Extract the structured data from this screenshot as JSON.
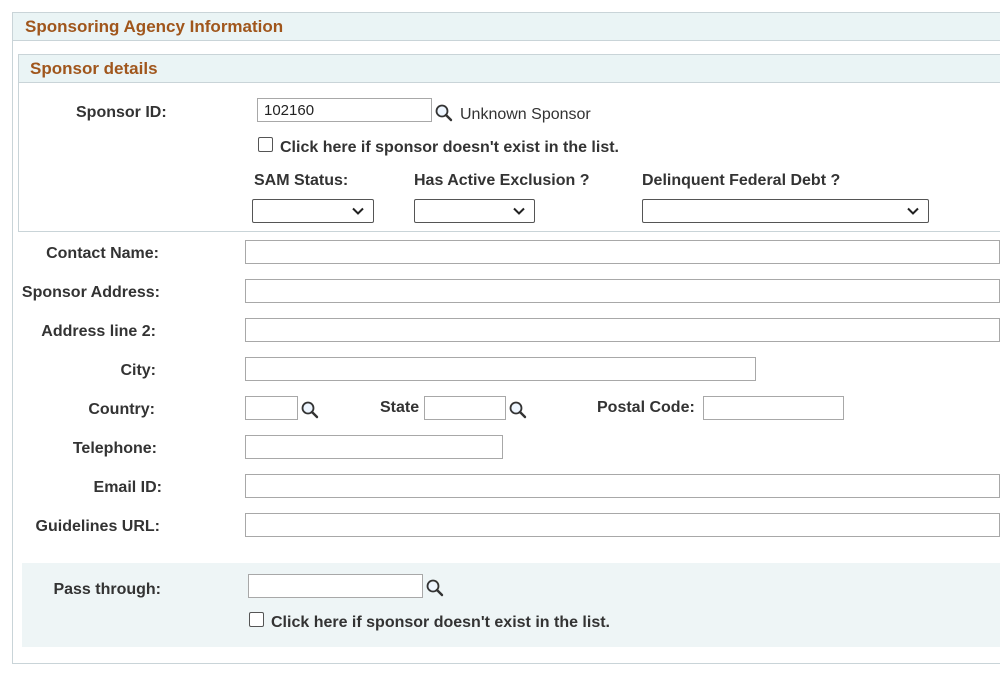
{
  "section": {
    "title": "Sponsoring Agency Information"
  },
  "sponsor_details": {
    "title": "Sponsor details",
    "sponsor_id_label": "Sponsor ID:",
    "sponsor_id_value": "102160",
    "sponsor_name": "Unknown Sponsor",
    "not_exist_label": "Click here if sponsor doesn't exist in the list.",
    "sam_status_label": "SAM Status:",
    "sam_status_value": "",
    "active_exclusion_label": "Has Active Exclusion ?",
    "active_exclusion_value": "",
    "delinquent_debt_label": "Delinquent Federal Debt ?",
    "delinquent_debt_value": ""
  },
  "contact": {
    "contact_name_label": "Contact Name:",
    "sponsor_address_label": "Sponsor Address:",
    "address_line2_label": "Address line 2:",
    "city_label": "City:",
    "country_label": "Country:",
    "state_label": "State",
    "postal_code_label": "Postal Code:",
    "telephone_label": "Telephone:",
    "email_label": "Email ID:",
    "guidelines_url_label": "Guidelines URL:"
  },
  "pass_through": {
    "label": "Pass through:",
    "not_exist_label": "Click here if sponsor doesn't exist in the list."
  },
  "icons": {
    "lookup": "magnifier-icon",
    "dropdown": "chevron-down-icon"
  }
}
